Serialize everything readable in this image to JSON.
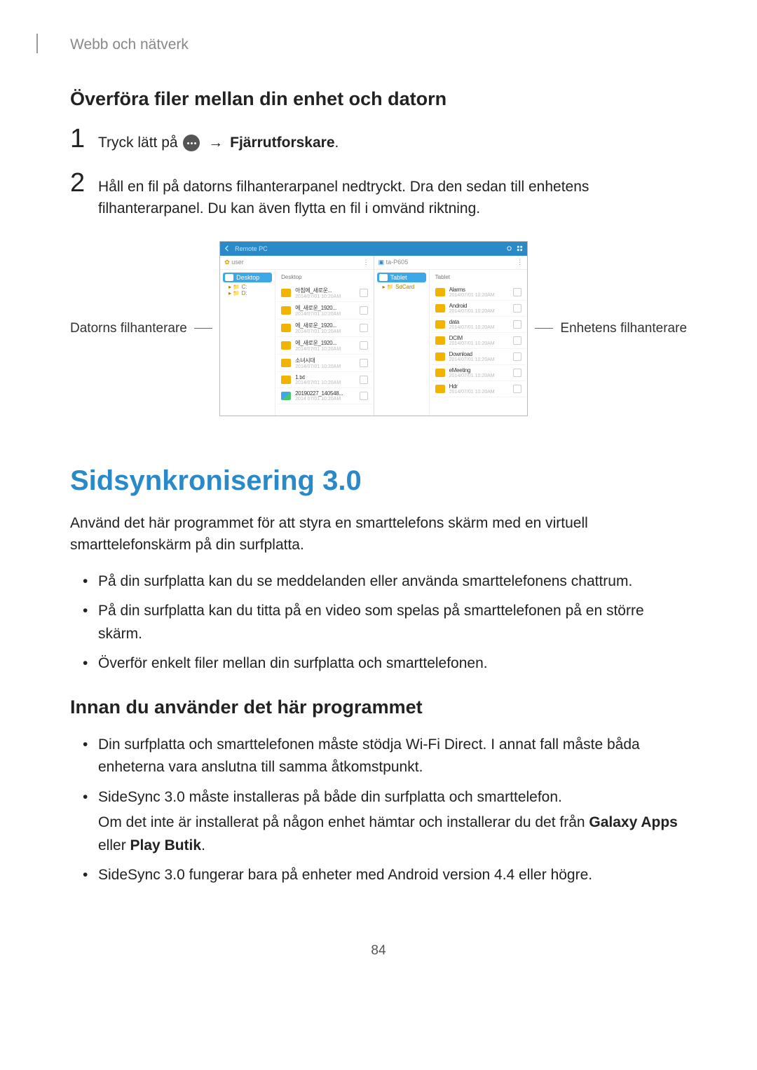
{
  "header": {
    "category": "Webb och nätverk"
  },
  "section1": {
    "title": "Överföra filer mellan din enhet och datorn",
    "step1_a": "Tryck lätt på",
    "step1_b": "Fjärrutforskare",
    "step1_c": ".",
    "arrow": "→",
    "step2": "Håll en fil på datorns filhanterarpanel nedtryckt. Dra den sedan till enhetens filhanterarpanel. Du kan även flytta en fil i omvänd riktning."
  },
  "figure": {
    "left_label": "Datorns filhanterare",
    "right_label": "Enhetens filhanterare",
    "titlebar_left": "Remote PC",
    "pane_left_header": "user",
    "pane_right_header": "ta-P605",
    "pane_left_sidebar_active": "Desktop",
    "pane_right_sidebar_active": "Tablet",
    "pane_right_sidebar_sub": "SdCard",
    "list_head_left": "Desktop",
    "list_head_right": "Tablet",
    "left_rows": [
      {
        "name": "아침에_새로운...",
        "meta": "2014/07/01 10:20AM",
        "icon": "folder"
      },
      {
        "name": "에_새로운_1920...",
        "meta": "2014/07/01 10:20AM",
        "icon": "folder"
      },
      {
        "name": "에_새로운_1920...",
        "meta": "2014/07/01 10:20AM",
        "icon": "folder"
      },
      {
        "name": "에_새로운_1920...",
        "meta": "2014/07/01 10:20AM",
        "icon": "folder"
      },
      {
        "name": "소녀시대",
        "meta": "2014/07/01 10:20AM",
        "icon": "folder"
      },
      {
        "name": "1.txt",
        "meta": "2014/07/01 10:20AM",
        "icon": "folder"
      },
      {
        "name": "20190227_140548...",
        "meta": "2014 07/01 10:20AM",
        "icon": "img"
      }
    ],
    "right_rows": [
      {
        "name": "Alarms",
        "meta": "2014/07/01 10:20AM"
      },
      {
        "name": "Android",
        "meta": "2014/07/01 10:20AM"
      },
      {
        "name": "data",
        "meta": "2014/07/01 10:20AM"
      },
      {
        "name": "DCIM",
        "meta": "2014/07/01 10:20AM"
      },
      {
        "name": "Download",
        "meta": "2014/07/01 10:20AM"
      },
      {
        "name": "eMeeting",
        "meta": "2014/07/01 10:20AM"
      },
      {
        "name": "Hdr",
        "meta": "2014/07/01 10:20AM"
      }
    ]
  },
  "section2": {
    "heading": "Sidsynkronisering 3.0",
    "intro": "Använd det här programmet för att styra en smarttelefons skärm med en virtuell smarttelefonskärm på din surfplatta.",
    "bullets": [
      "På din surfplatta kan du se meddelanden eller använda smarttelefonens chattrum.",
      "På din surfplatta kan du titta på en video som spelas på smarttelefonen på en större skärm.",
      "Överför enkelt filer mellan din surfplatta och smarttelefonen."
    ],
    "subheading": "Innan du använder det här programmet",
    "bullets2": [
      {
        "text": "Din surfplatta och smarttelefonen måste stödja Wi-Fi Direct. I annat fall måste båda enheterna vara anslutna till samma åtkomstpunkt."
      },
      {
        "text": "SideSync 3.0 måste installeras på både din surfplatta och smarttelefon.",
        "extra_a": "Om det inte är installerat på någon enhet hämtar och installerar du det från ",
        "extra_b1": "Galaxy Apps",
        "extra_mid": " eller ",
        "extra_b2": "Play Butik",
        "extra_end": "."
      },
      {
        "text": "SideSync 3.0 fungerar bara på enheter med Android version 4.4 eller högre."
      }
    ]
  },
  "page_number": "84"
}
